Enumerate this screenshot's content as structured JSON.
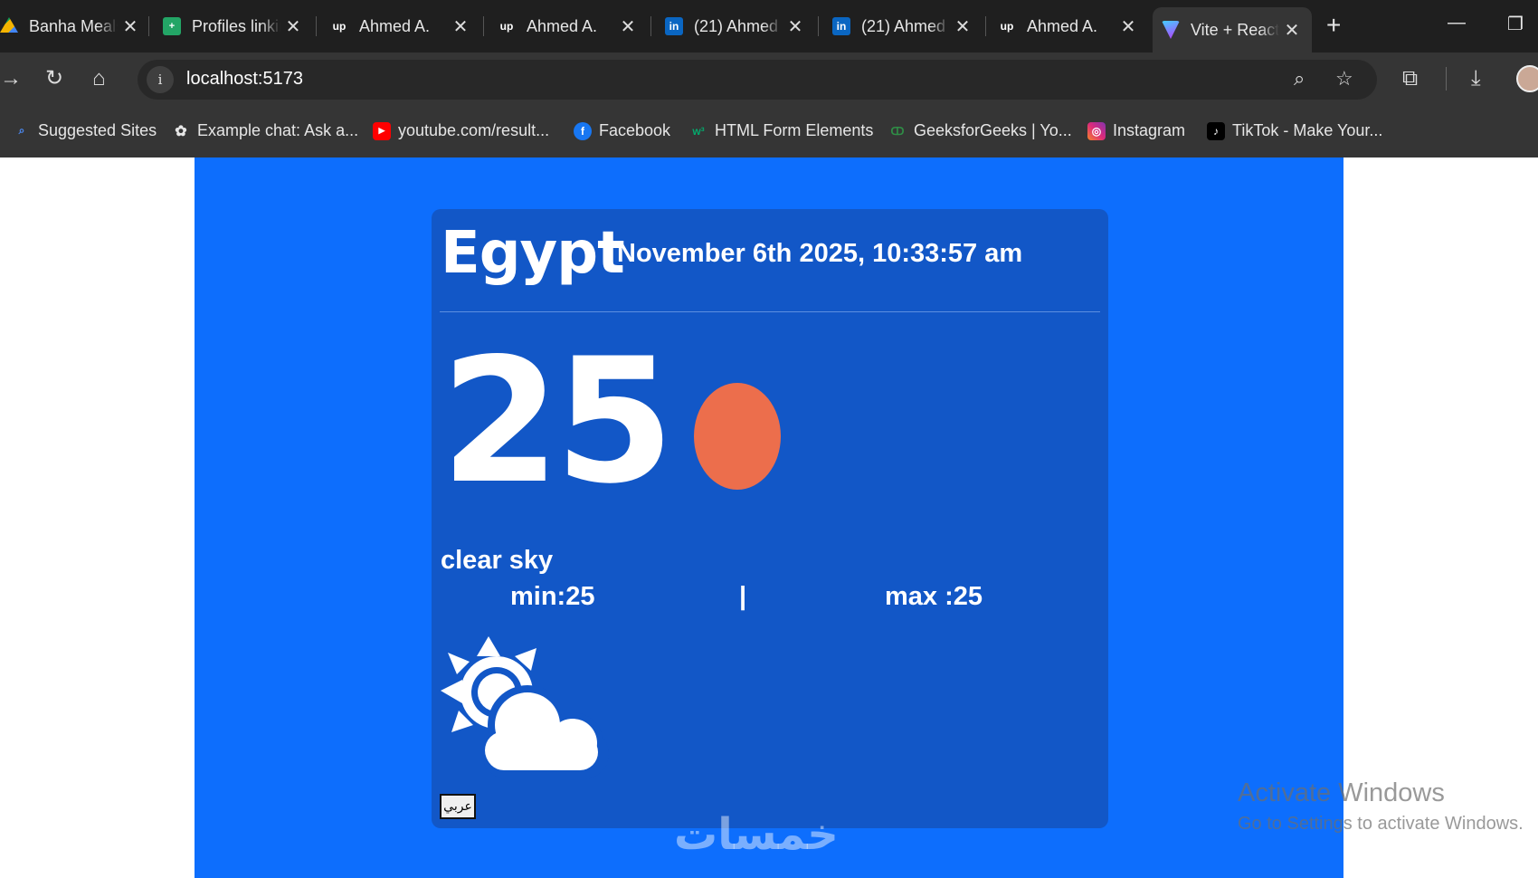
{
  "browser": {
    "tabs": [
      {
        "title": "Banha Meals",
        "icon": "google-drive-icon"
      },
      {
        "title": "Profiles linking",
        "icon": "google-sheets-icon"
      },
      {
        "title": "Ahmed A.",
        "icon": "upwork-icon"
      },
      {
        "title": "Ahmed A.",
        "icon": "upwork-icon"
      },
      {
        "title": "(21) Ahmed",
        "icon": "linkedin-icon"
      },
      {
        "title": "(21) Ahmed",
        "icon": "linkedin-icon"
      },
      {
        "title": "Ahmed A.",
        "icon": "upwork-icon"
      },
      {
        "title": "Vite + React",
        "icon": "vite-icon",
        "active": true
      }
    ],
    "url": "localhost:5173",
    "bookmarks": [
      {
        "label": "Suggested Sites"
      },
      {
        "label": "Example chat: Ask a..."
      },
      {
        "label": "youtube.com/result..."
      },
      {
        "label": "Facebook"
      },
      {
        "label": "HTML Form Elements"
      },
      {
        "label": "GeeksforGeeks | Yo..."
      },
      {
        "label": "Instagram"
      },
      {
        "label": "TikTok - Make Your..."
      }
    ]
  },
  "weather": {
    "city": "Egypt",
    "datetime": "November 6th 2025, 10:33:57 am",
    "temperature": "25",
    "description": "clear sky",
    "min": "min:25",
    "separator": "|",
    "max": "max :25",
    "condition_icon": "sun-behind-cloud-icon",
    "language_button": "عربي"
  },
  "overlays": {
    "watermark": "خمسات",
    "activate_title": "Activate Windows",
    "activate_sub": "Go to Settings to activate Windows."
  },
  "colors": {
    "app_background": "#0d6efd",
    "card_background": "#1257c7",
    "weather_dot": "#ec6e4c",
    "chrome_dark": "#1f1f1f"
  }
}
